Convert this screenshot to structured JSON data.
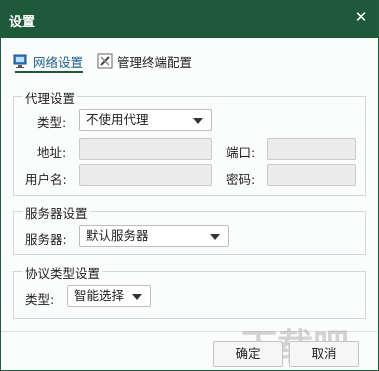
{
  "window": {
    "title": "设置",
    "close_glyph": "✕"
  },
  "tabs": [
    {
      "label": "网络设置",
      "icon": "network-icon",
      "active": true
    },
    {
      "label": "管理终端配置",
      "icon": "tools-icon",
      "active": false
    }
  ],
  "proxy": {
    "group_title": "代理设置",
    "type_label": "类型:",
    "type_value": "不使用代理",
    "address_label": "地址:",
    "address_value": "",
    "port_label": "端口:",
    "port_value": "",
    "username_label": "用户名:",
    "username_value": "",
    "password_label": "密码:",
    "password_value": ""
  },
  "server": {
    "group_title": "服务器设置",
    "server_label": "服务器:",
    "server_value": "默认服务器"
  },
  "protocol": {
    "group_title": "协议类型设置",
    "type_label": "类型:",
    "type_value": "智能选择"
  },
  "footer": {
    "ok_label": "确定",
    "cancel_label": "取消"
  },
  "watermark": {
    "text": "下载吧"
  },
  "colors": {
    "titlebar": "#1e5a3a",
    "active_tab_text": "#1b5e8c"
  }
}
